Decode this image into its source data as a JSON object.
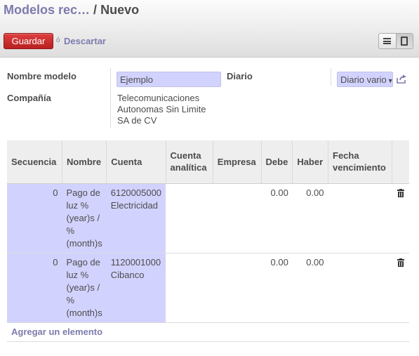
{
  "breadcrumb": {
    "parent": "Modelos rec…",
    "separator": "/",
    "current": "Nuevo"
  },
  "toolbar": {
    "save_label": "Guardar",
    "or_label": "ó",
    "discard_label": "Descartar"
  },
  "view_switcher": [
    "list-view",
    "form-view"
  ],
  "form": {
    "name_label": "Nombre modelo",
    "name_value": "Ejemplo",
    "company_label": "Compañía",
    "company_lines": [
      "Telecomunicaciones",
      "Autonomas Sin Limite",
      "SA de CV"
    ],
    "journal_label": "Diario",
    "journal_value": "Diario vario"
  },
  "table": {
    "headers": [
      "Secuencia",
      "Nombre",
      "Cuenta",
      "Cuenta analítica",
      "Empresa",
      "Debe",
      "Haber",
      "Fecha vencimiento",
      ""
    ],
    "rows": [
      {
        "sequence": "0",
        "name": [
          "Pago de",
          "luz %",
          "(year)s /",
          "%",
          "(month)s"
        ],
        "account": [
          "6120005000",
          "Electricidad"
        ],
        "analytic": "",
        "partner": "",
        "debit": "0.00",
        "credit": "0.00",
        "due": ""
      },
      {
        "sequence": "0",
        "name": [
          "Pago de",
          "luz %",
          "(year)s /",
          "%",
          "(month)s"
        ],
        "account": [
          "1120001000",
          "Cibanco"
        ],
        "analytic": "",
        "partner": "",
        "debit": "0.00",
        "credit": "0.00",
        "due": ""
      }
    ],
    "add_label": "Agregar un elemento"
  },
  "colors": {
    "accent": "#7c7bad",
    "primary_button": "#c62b2b",
    "required_field": "#d2d2ff"
  },
  "icons": [
    "list-icon",
    "form-icon",
    "external-link-icon",
    "trash-icon"
  ]
}
